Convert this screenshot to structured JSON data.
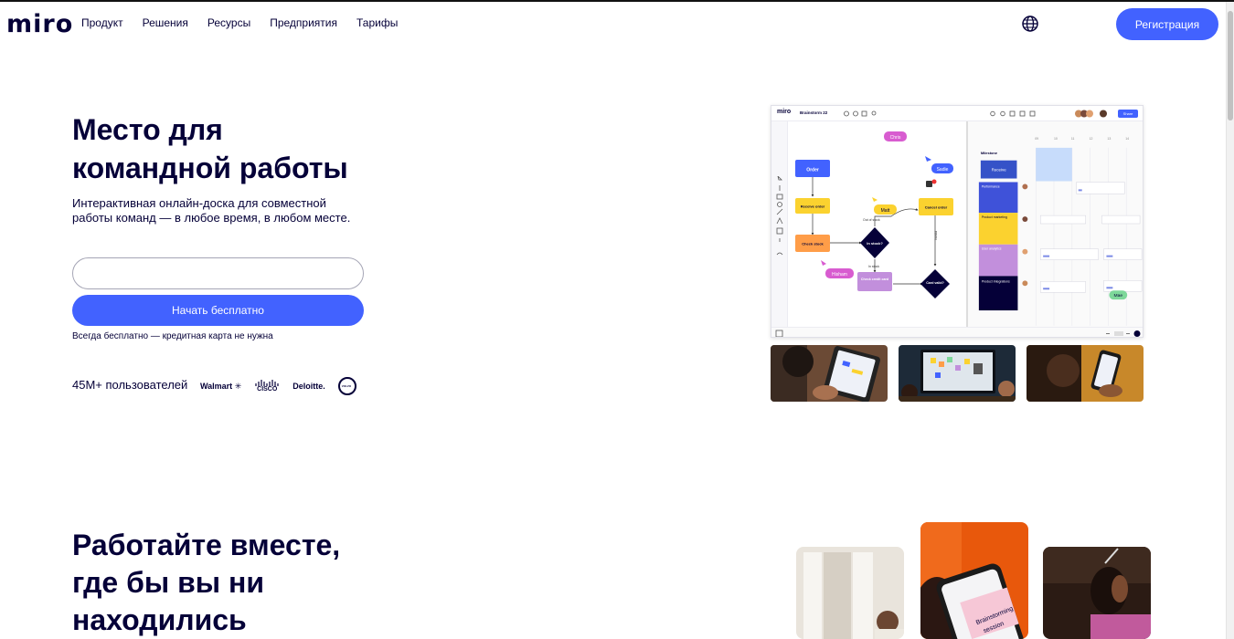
{
  "header": {
    "logo": "miro",
    "nav": [
      "Продукт",
      "Решения",
      "Ресурсы",
      "Предприятия",
      "Тарифы"
    ],
    "signup_label": "Регистрация"
  },
  "hero": {
    "title_line1": "Место для",
    "title_line2": "командной работы",
    "subtitle_line1": "Интерактивная онлайн-доска для совместной",
    "subtitle_line2": "работы команд — в любое время, в любом месте.",
    "email_value": "",
    "cta_label": "Начать бесплатно",
    "note": "Всегда бесплатно — кредитная карта не нужна",
    "users": "45M+ пользователей",
    "brand_logos": [
      "Walmart",
      "CISCO",
      "Deloitte.",
      "VOLVO"
    ]
  },
  "board": {
    "logo": "miro",
    "board_name": "Brainstorm 22",
    "share": "Share",
    "flow_nodes": {
      "order": "Order",
      "receive_order": "Receive order",
      "check_stock": "Check stock",
      "in_stock_q": "In stock?",
      "out_of_stock": "Out of stock",
      "in_stock": "In stock",
      "check_credit_card": "Check credit card",
      "cancel_order": "Cancel order",
      "card_valid_q": "Card valid?",
      "invalid": "Invalid"
    },
    "cursors": {
      "chris": "Chris",
      "sadie": "Sadie",
      "matt": "Matt",
      "hisham": "Hisham",
      "mae": "Mae"
    },
    "timeline": {
      "title": "Milestone",
      "receive": "Receive",
      "columns": [
        "09",
        "10",
        "11",
        "12",
        "13",
        "14"
      ],
      "rows": [
        "Performance",
        "Product marketing",
        "User analytics",
        "Product Integrations"
      ]
    }
  },
  "section2": {
    "line1": "Работайте вместе,",
    "line2": "где бы вы ни",
    "line3": "находились"
  },
  "phone_card": {
    "text_line1": "Brainstorming",
    "text_line2": "session"
  },
  "colors": {
    "brand": "#4262ff",
    "text": "#050038"
  }
}
